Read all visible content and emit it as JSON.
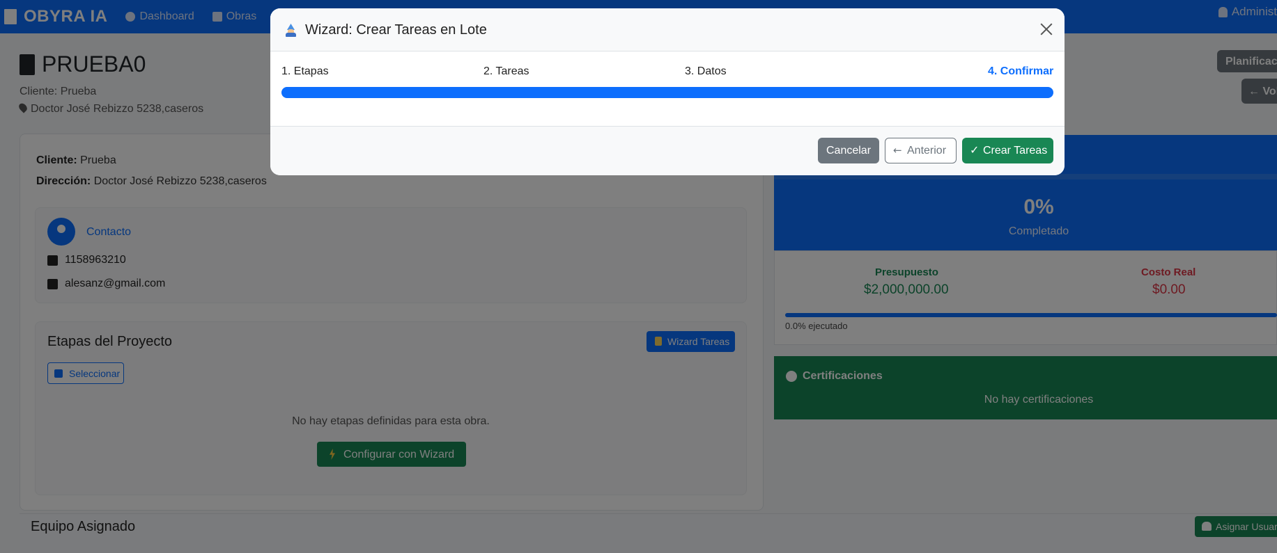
{
  "navbar": {
    "brand": "OBYRA IA",
    "items": [
      "Dashboard",
      "Obras"
    ],
    "user": "Administ"
  },
  "page": {
    "title": "PRUEBA0",
    "cliente": "Cliente: Prueba",
    "direccion": "Doctor José Rebizzo 5238,caseros",
    "btn_planificacion": "Planificac",
    "btn_volver": "← Vol"
  },
  "info": {
    "cliente_label": "Cliente:",
    "cliente_value": " Prueba",
    "direccion_label": "Dirección:",
    "direccion_value": " Doctor José Rebizzo 5238,caseros"
  },
  "contacto": {
    "label": "Contacto",
    "phone": "1158963210",
    "email": "alesanz@gmail.com"
  },
  "etapas": {
    "title": "Etapas del Proyecto",
    "wizard_button": "Wizard Tareas",
    "select_button": "Seleccionar",
    "empty": "No hay etapas definidas para esta obra.",
    "config_button": "Configurar con Wizard"
  },
  "equipo": {
    "title": "Equipo Asignado",
    "assign_button": "Asignar Usuar"
  },
  "progress": {
    "percent": "0%",
    "label": "Completado",
    "fraction": 0
  },
  "budget": {
    "presupuesto_label": "Presupuesto",
    "presupuesto_value": "$2,000,000.00",
    "costo_label": "Costo Real",
    "costo_value": "$0.00",
    "ejecutado": "0.0% ejecutado"
  },
  "certificaciones": {
    "title": "Certificaciones",
    "empty": "No hay certificaciones"
  },
  "modal": {
    "title": "Wizard: Crear Tareas en Lote",
    "steps": [
      "1. Etapas",
      "2. Tareas",
      "3. Datos",
      "4. Confirmar"
    ],
    "active_step": 4,
    "progress_percent": 100,
    "cancel": "Cancelar",
    "previous": "Anterior",
    "create": "Crear Tareas"
  },
  "colors": {
    "primary": "#0d6efd",
    "success": "#198754",
    "secondary": "#6c757d",
    "danger": "#dc3545"
  }
}
